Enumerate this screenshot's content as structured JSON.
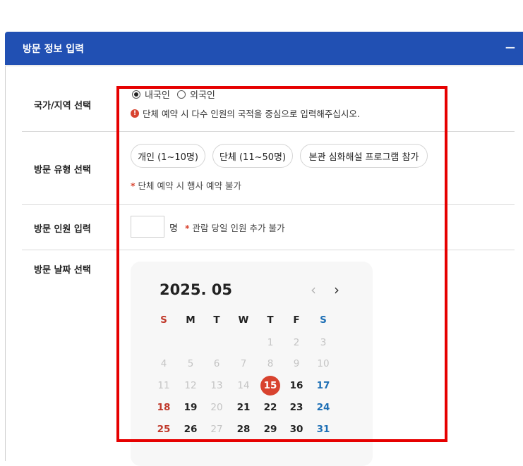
{
  "header": {
    "title": "방문 정보 입력",
    "collapse_icon": "minus-icon",
    "collapse_label": "−",
    "bg_color": "#2150b3"
  },
  "rows": {
    "country": {
      "label": "국가/지역 선택",
      "options": [
        {
          "label": "내국인",
          "selected": true
        },
        {
          "label": "외국인",
          "selected": false
        }
      ],
      "notice_icon": "!",
      "notice": "단체 예약 시 다수 인원의 국적을 중심으로 입력해주십시오."
    },
    "type": {
      "label": "방문 유형 선택",
      "options": [
        "개인 (1~10명)",
        "단체 (11~50명)",
        "본관 심화해설 프로그램 참가"
      ],
      "note_mark": "*",
      "note": "단체 예약 시 행사 예약 불가"
    },
    "count": {
      "label": "방문 인원 입력",
      "value": "",
      "unit": "명",
      "note_mark": "*",
      "note": "관람 당일 인원 추가 불가"
    },
    "date": {
      "label": "방문 날짜 선택"
    }
  },
  "calendar": {
    "month_label": "2025. 05",
    "prev_icon": "chevron-left-icon",
    "next_icon": "chevron-right-icon",
    "prev_label": "‹",
    "next_label": "›",
    "weekdays": [
      "S",
      "M",
      "T",
      "W",
      "T",
      "F",
      "S"
    ],
    "selected_day": 15,
    "accent_color": "#d8432f",
    "weeks": [
      [
        "",
        "",
        "",
        "",
        "1",
        "2",
        "3"
      ],
      [
        "4",
        "5",
        "6",
        "7",
        "8",
        "9",
        "10"
      ],
      [
        "11",
        "12",
        "13",
        "14",
        "15",
        "16",
        "17"
      ],
      [
        "18",
        "19",
        "20",
        "21",
        "22",
        "23",
        "24"
      ],
      [
        "25",
        "26",
        "27",
        "28",
        "29",
        "30",
        "31"
      ]
    ],
    "unavailable": [
      "1",
      "2",
      "3",
      "4",
      "5",
      "6",
      "7",
      "8",
      "9",
      "10",
      "11",
      "12",
      "13",
      "14",
      "20",
      "27"
    ]
  }
}
